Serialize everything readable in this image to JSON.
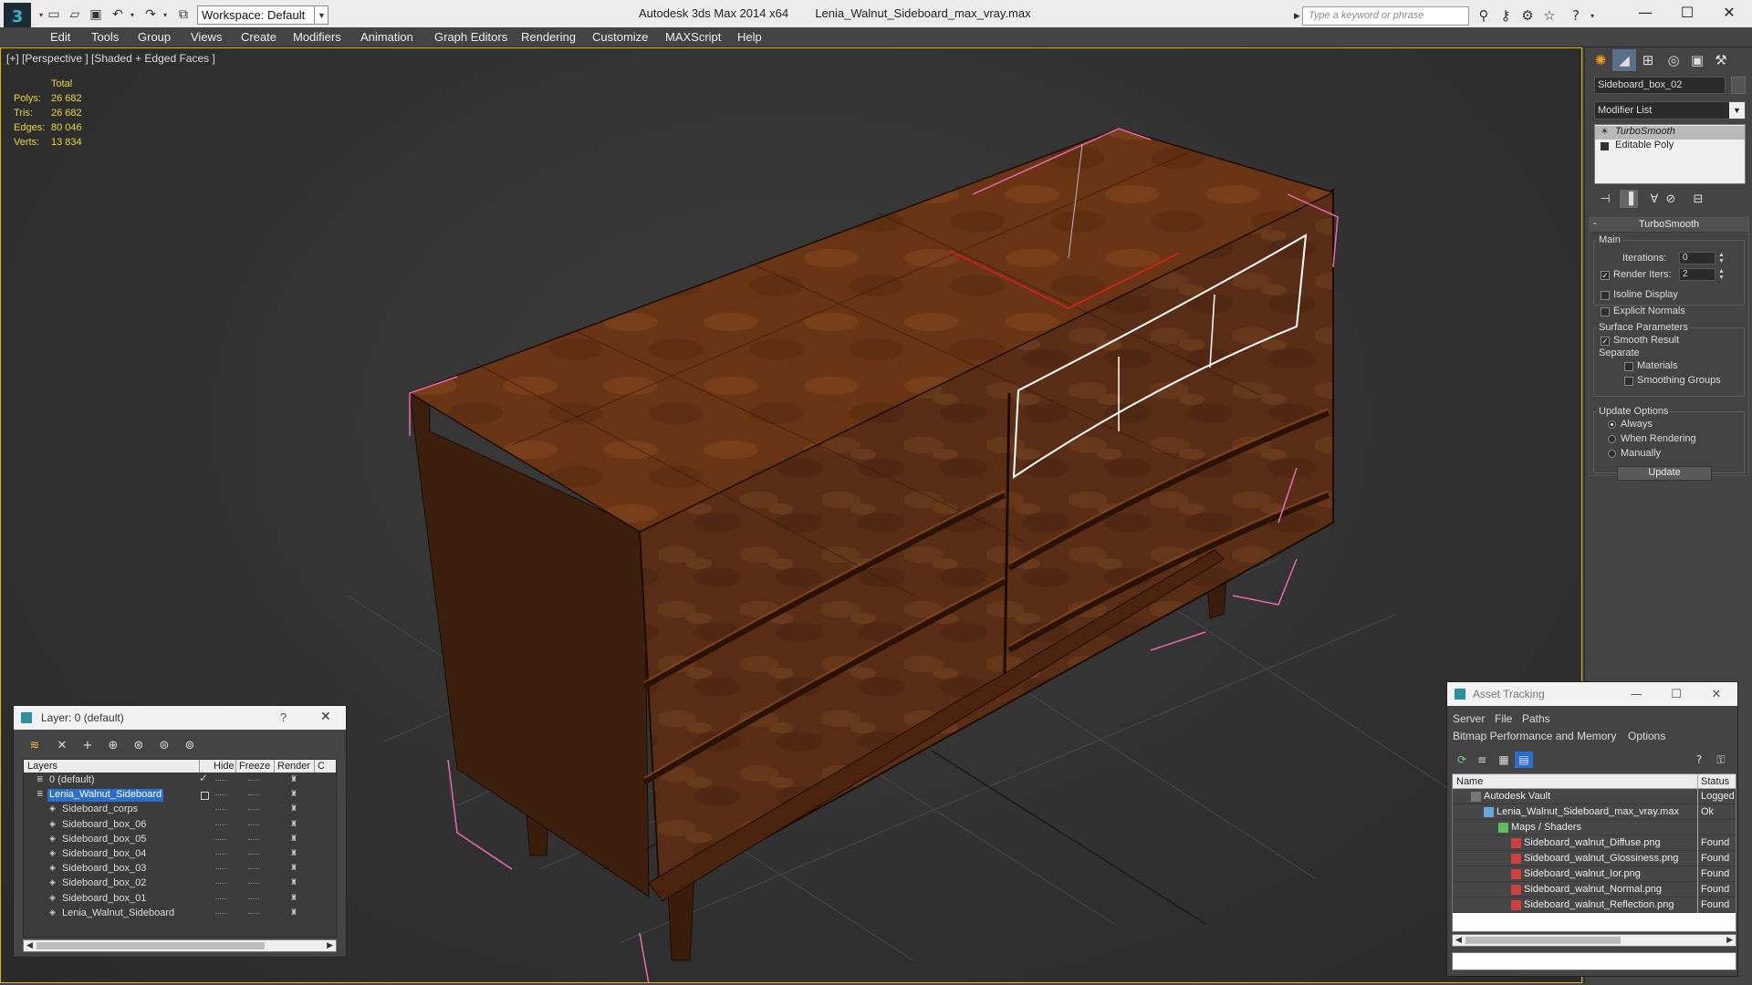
{
  "title_bar": {
    "workspace": "Workspace: Default",
    "app_name": "Autodesk 3ds Max  2014 x64",
    "file_name": "Lenia_Walnut_Sideboard_max_vray.max",
    "search_placeholder": "Type a keyword or phrase"
  },
  "menu": [
    "Edit",
    "Tools",
    "Group",
    "Views",
    "Create",
    "Modifiers",
    "Animation",
    "Graph Editors",
    "Rendering",
    "Customize",
    "MAXScript",
    "Help"
  ],
  "viewport": {
    "label": "[+] [Perspective ] [Shaded + Edged Faces ]",
    "stats_header": "Total",
    "stats": [
      {
        "label": "Polys:",
        "value": "26 682"
      },
      {
        "label": "Tris:",
        "value": "26 682"
      },
      {
        "label": "Edges:",
        "value": "80 046"
      },
      {
        "label": "Verts:",
        "value": "13 834"
      }
    ],
    "accent_color": "#e7b400"
  },
  "command_panel": {
    "object_name": "Sideboard_box_02",
    "modifier_list": "Modifier List",
    "stack": [
      "TurboSmooth",
      "Editable Poly"
    ],
    "rollout_title": "TurboSmooth",
    "main_group": "Main",
    "iterations_label": "Iterations:",
    "iterations_value": "0",
    "render_iters_label": "Render Iters:",
    "render_iters_value": "2",
    "isoline_label": "Isoline Display",
    "explicit_normals_label": "Explicit Normals",
    "surface_group": "Surface Parameters",
    "smooth_result_label": "Smooth Result",
    "separate_label": "Separate",
    "materials_label": "Materials",
    "smoothing_groups_label": "Smoothing Groups",
    "update_group": "Update Options",
    "always_label": "Always",
    "when_rendering_label": "When Rendering",
    "manually_label": "Manually",
    "update_button": "Update"
  },
  "layer_window": {
    "title": "Layer: 0 (default)",
    "help": "?",
    "columns": [
      "Layers",
      "Hide",
      "Freeze",
      "Render",
      "C"
    ],
    "rows": [
      {
        "name": "0 (default)"
      },
      {
        "name": "Lenia_Walnut_Sideboard"
      },
      {
        "name": "Sideboard_corps"
      },
      {
        "name": "Sideboard_box_06"
      },
      {
        "name": "Sideboard_box_05"
      },
      {
        "name": "Sideboard_box_04"
      },
      {
        "name": "Sideboard_box_03"
      },
      {
        "name": "Sideboard_box_02"
      },
      {
        "name": "Sideboard_box_01"
      },
      {
        "name": "Lenia_Walnut_Sideboard"
      }
    ]
  },
  "asset_window": {
    "title": "Asset Tracking",
    "menu_row1": [
      "Server",
      "File",
      "Paths"
    ],
    "menu_row2": [
      "Bitmap Performance and Memory",
      "Options"
    ],
    "columns": [
      "Name",
      "Status"
    ],
    "rows": [
      {
        "name": "Autodesk Vault",
        "status": "Logged"
      },
      {
        "name": "Lenia_Walnut_Sideboard_max_vray.max",
        "status": "Ok"
      },
      {
        "name": "Maps / Shaders",
        "status": ""
      },
      {
        "name": "Sideboard_walnut_Diffuse.png",
        "status": "Found"
      },
      {
        "name": "Sideboard_walnut_Glossiness.png",
        "status": "Found"
      },
      {
        "name": "Sideboard_walnut_Ior.png",
        "status": "Found"
      },
      {
        "name": "Sideboard_walnut_Normal.png",
        "status": "Found"
      },
      {
        "name": "Sideboard_walnut_Reflection.png",
        "status": "Found"
      }
    ]
  }
}
